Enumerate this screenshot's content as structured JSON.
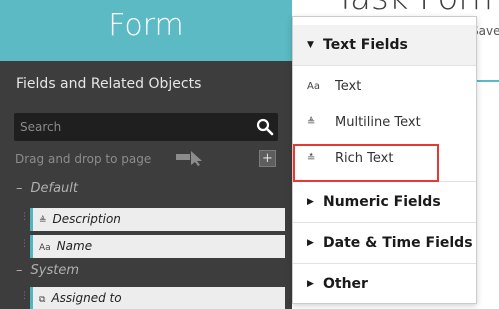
{
  "header": {
    "title": "Form"
  },
  "background": {
    "page_title": "Task Form",
    "saved_status": "Saved"
  },
  "panel": {
    "fields_title": "Fields and Related Objects",
    "search_placeholder": "Search",
    "drag_hint": "Drag and drop to page",
    "add_label": "+",
    "groups": [
      {
        "name": "Default",
        "items": [
          {
            "icon": "rich-text-icon",
            "label": "Description"
          },
          {
            "icon": "text-icon",
            "label": "Name"
          }
        ]
      },
      {
        "name": "System",
        "items": [
          {
            "icon": "assign-icon",
            "label": "Assigned to"
          }
        ]
      }
    ]
  },
  "menu": {
    "sections": [
      {
        "label": "Text Fields",
        "state": "expanded"
      },
      {
        "label": "Numeric Fields",
        "state": "collapsed"
      },
      {
        "label": "Date & Time Fields",
        "state": "collapsed"
      },
      {
        "label": "Other",
        "state": "collapsed"
      }
    ],
    "text_items": [
      {
        "icon_glyph": "Aa",
        "icon": "text-icon",
        "label": "Text"
      },
      {
        "icon_glyph": "≜",
        "icon": "multiline-text-icon",
        "label": "Multiline Text"
      },
      {
        "icon_glyph": "≛",
        "icon": "rich-text-icon",
        "label": "Rich Text",
        "highlighted": true
      }
    ]
  },
  "colors": {
    "header_teal": "#5bbac3",
    "panel_bg": "#3d3d3d",
    "highlight_red": "#e53935"
  }
}
